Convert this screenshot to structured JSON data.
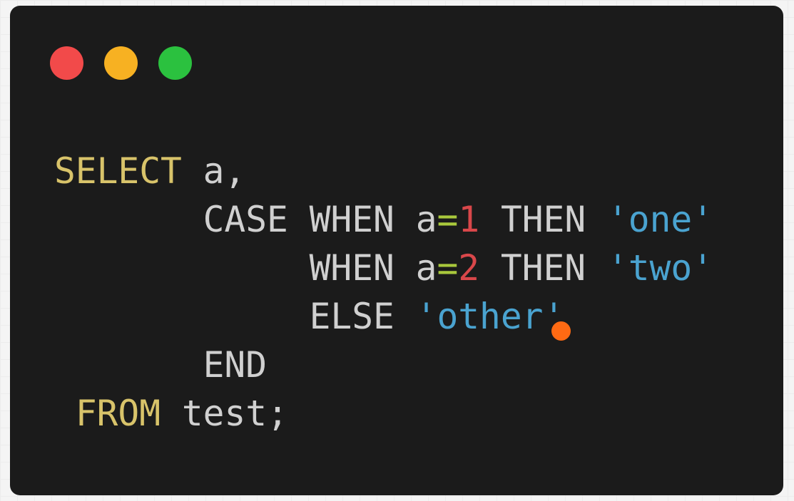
{
  "window": {
    "background": "#1b1b1b",
    "buttons": {
      "close_color": "#f24a4a",
      "minimize_color": "#f7b122",
      "maximize_color": "#2bc13f"
    }
  },
  "editor": {
    "language": "sql",
    "lines": [
      {
        "indent": "",
        "tokens": [
          {
            "text": "SELECT",
            "type": "kw-main"
          },
          {
            "text": " ",
            "type": "ident"
          },
          {
            "text": "a",
            "type": "ident"
          },
          {
            "text": ",",
            "type": "punct"
          }
        ]
      },
      {
        "indent": "       ",
        "tokens": [
          {
            "text": "CASE",
            "type": "kw"
          },
          {
            "text": " ",
            "type": "ident"
          },
          {
            "text": "WHEN",
            "type": "kw"
          },
          {
            "text": " ",
            "type": "ident"
          },
          {
            "text": "a",
            "type": "ident"
          },
          {
            "text": "=",
            "type": "op"
          },
          {
            "text": "1",
            "type": "num"
          },
          {
            "text": " ",
            "type": "ident"
          },
          {
            "text": "THEN",
            "type": "kw"
          },
          {
            "text": " ",
            "type": "ident"
          },
          {
            "text": "'one'",
            "type": "str"
          }
        ]
      },
      {
        "indent": "            ",
        "tokens": [
          {
            "text": "WHEN",
            "type": "kw"
          },
          {
            "text": " ",
            "type": "ident"
          },
          {
            "text": "a",
            "type": "ident"
          },
          {
            "text": "=",
            "type": "op"
          },
          {
            "text": "2",
            "type": "num"
          },
          {
            "text": " ",
            "type": "ident"
          },
          {
            "text": "THEN",
            "type": "kw"
          },
          {
            "text": " ",
            "type": "ident"
          },
          {
            "text": "'two'",
            "type": "str"
          }
        ]
      },
      {
        "indent": "            ",
        "tokens": [
          {
            "text": "ELSE",
            "type": "kw"
          },
          {
            "text": " ",
            "type": "ident"
          },
          {
            "text": "'other'",
            "type": "str"
          }
        ]
      },
      {
        "indent": "       ",
        "tokens": [
          {
            "text": "END",
            "type": "kw"
          }
        ]
      },
      {
        "indent": " ",
        "tokens": [
          {
            "text": "FROM",
            "type": "kw-main"
          },
          {
            "text": " ",
            "type": "ident"
          },
          {
            "text": "test",
            "type": "ident"
          },
          {
            "text": ";",
            "type": "punct"
          }
        ]
      }
    ]
  },
  "cursor": {
    "color": "#ff6a13",
    "icon": "cursor-dot-icon"
  }
}
